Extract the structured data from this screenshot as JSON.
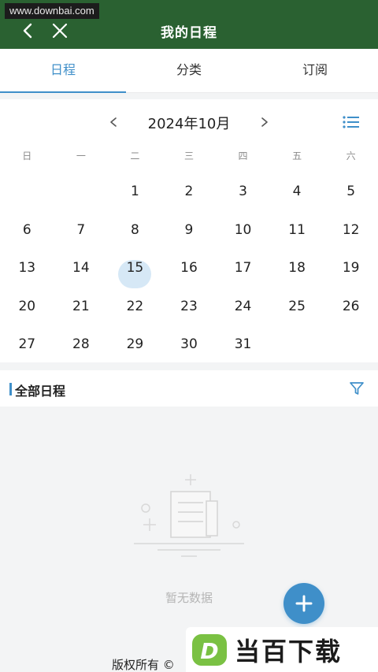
{
  "watermark_top": "www.downbai.com",
  "header": {
    "title": "我的日程",
    "back_icon": "back-arrow-icon",
    "close_icon": "close-icon"
  },
  "tabs": [
    {
      "label": "日程",
      "active": true
    },
    {
      "label": "分类",
      "active": false
    },
    {
      "label": "订阅",
      "active": false
    }
  ],
  "calendar": {
    "month_label": "2024年10月",
    "weekdays": [
      "日",
      "一",
      "二",
      "三",
      "四",
      "五",
      "六"
    ],
    "weeks": [
      [
        "",
        "",
        "1",
        "2",
        "3",
        "4",
        "5"
      ],
      [
        "6",
        "7",
        "8",
        "9",
        "10",
        "11",
        "12"
      ],
      [
        "13",
        "14",
        "15",
        "16",
        "17",
        "18",
        "19"
      ],
      [
        "20",
        "21",
        "22",
        "23",
        "24",
        "25",
        "26"
      ],
      [
        "27",
        "28",
        "29",
        "30",
        "31",
        "",
        ""
      ]
    ],
    "selected_day": "15",
    "accent_color": "#3f8fc9",
    "selected_bg_color": "#d6e8f6"
  },
  "section": {
    "title": "全部日程"
  },
  "empty": {
    "text": "暂无数据"
  },
  "footer": {
    "text": "版权所有 ©"
  },
  "brand_watermark": {
    "logo_letter": "D",
    "text": "当百下载"
  },
  "colors": {
    "header_bg": "#2a6131",
    "accent": "#3f8fc9"
  }
}
